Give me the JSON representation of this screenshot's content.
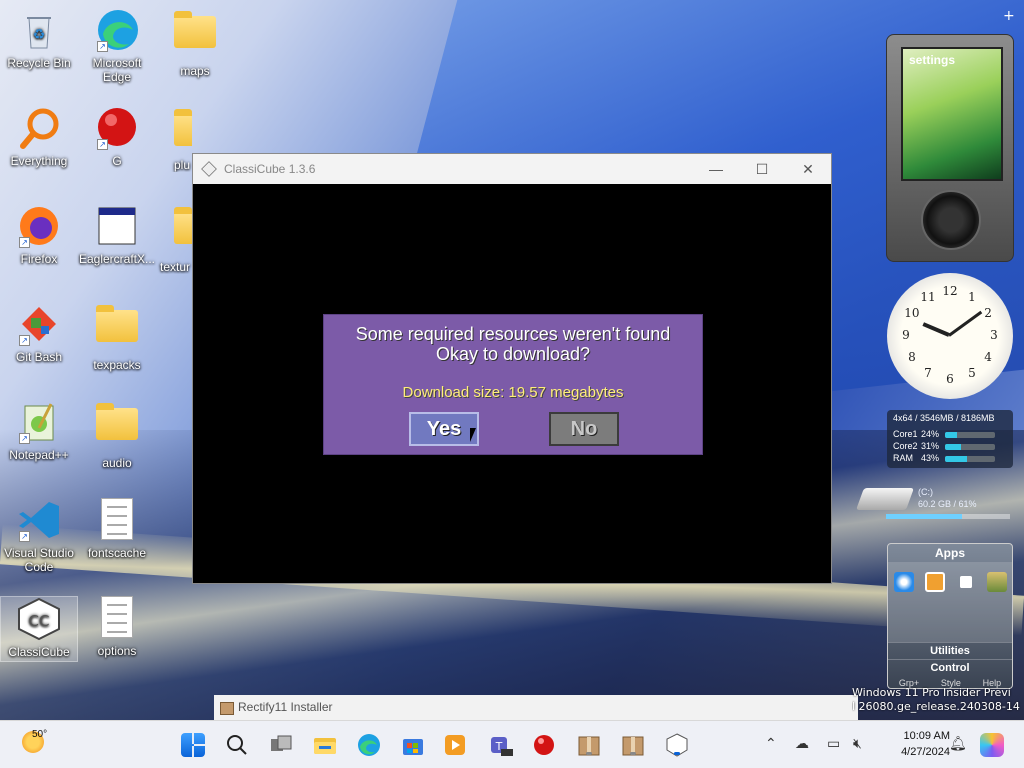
{
  "desktop": {
    "icons": [
      {
        "label": "Recycle Bin"
      },
      {
        "label": "Microsoft Edge"
      },
      {
        "label": "maps"
      },
      {
        "label": "Everything"
      },
      {
        "label": "G"
      },
      {
        "label": "plu"
      },
      {
        "label": "Firefox"
      },
      {
        "label": "EaglercraftX..."
      },
      {
        "label": "textur"
      },
      {
        "label": "Git Bash"
      },
      {
        "label": "texpacks"
      },
      {
        "label": "Notepad++"
      },
      {
        "label": "audio"
      },
      {
        "label": "Visual Studio Code"
      },
      {
        "label": "fontscache"
      },
      {
        "label": "ClassiCube"
      },
      {
        "label": "options"
      }
    ]
  },
  "window": {
    "title": "ClassiCube 1.3.6",
    "minimize": "—",
    "maximize": "☐",
    "close": "✕"
  },
  "dialog": {
    "line1": "Some required resources weren't found",
    "line2": "Okay to download?",
    "size_text": "Download size: 19.57 megabytes",
    "yes": "Yes",
    "no": "No"
  },
  "gadgets": {
    "zune_screen": "settings",
    "meter": {
      "header": "4x64 / 3546MB / 8186MB",
      "rows": [
        {
          "label": "Core1",
          "pct": "24%",
          "value": 24
        },
        {
          "label": "Core2",
          "pct": "31%",
          "value": 31
        },
        {
          "label": "RAM",
          "pct": "43%",
          "value": 43
        }
      ]
    },
    "drive": {
      "label": "(C:)",
      "usage": "60.2 GB / 61%",
      "value": 61
    },
    "apps": {
      "title": "Apps",
      "utilities": "Utilities",
      "control": "Control",
      "footer": [
        "Grp+",
        "Style",
        "Help"
      ]
    },
    "clock_numbers": [
      "12",
      "1",
      "2",
      "3",
      "4",
      "5",
      "6",
      "7",
      "8",
      "9",
      "10",
      "11"
    ]
  },
  "notification": {
    "installer": "Rectify11 Installer"
  },
  "watermark": {
    "line1": "Windows 11 Pro Insider Previ",
    "line2": "l 26080.ge_release.240308-14"
  },
  "taskbar": {
    "temperature": "50°",
    "time": "10:09 AM",
    "date": "4/27/2024"
  },
  "colors": {
    "dialog_bg": "#7c5ba8",
    "yes_bg": "#7179c0",
    "no_bg": "#7c7c7c",
    "size_text": "#ffee7a"
  }
}
